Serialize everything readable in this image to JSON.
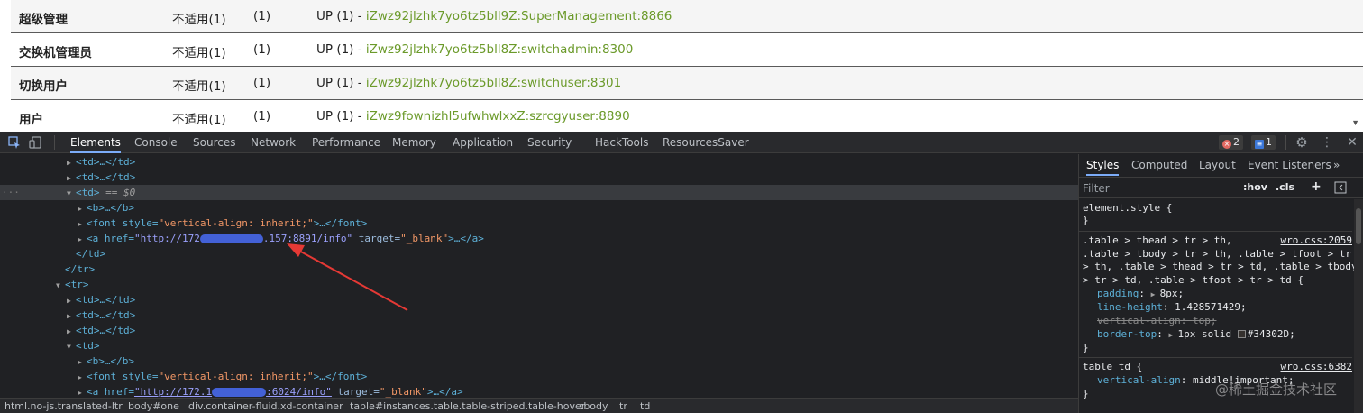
{
  "page_table": {
    "rows": [
      {
        "name": "超级管理",
        "status": "不适用(1)",
        "count": "(1)",
        "up_prefix": "UP (1) - ",
        "up_link": "iZwz92jlzhk7yo6tz5bll9Z:SuperManagement:8866"
      },
      {
        "name": "交换机管理员",
        "status": "不适用(1)",
        "count": "(1)",
        "up_prefix": "UP (1) - ",
        "up_link": "iZwz92jlzhk7yo6tz5bll8Z:switchadmin:8300"
      },
      {
        "name": "切换用户",
        "status": "不适用(1)",
        "count": "(1)",
        "up_prefix": "UP (1) - ",
        "up_link": "iZwz92jlzhk7yo6tz5bll8Z:switchuser:8301"
      },
      {
        "name": "用户",
        "status": "不适用(1)",
        "count": "(1)",
        "up_prefix": "UP (1) - ",
        "up_link": "iZwz9fownizhl5ufwhwlxxZ:szrcgyuser:8890"
      }
    ]
  },
  "devtools": {
    "tabs": [
      "Elements",
      "Console",
      "Sources",
      "Network",
      "Performance",
      "Memory",
      "Application",
      "Security",
      "HackTools",
      "ResourcesSaver"
    ],
    "active_tab": "Elements",
    "error_count": "2",
    "message_count": "1",
    "dom": {
      "td_collapsed": "<td>…</td>",
      "td_open": "<td>",
      "selected_suffix": " == $0",
      "b_collapsed": "<b>…</b>",
      "font_open": "<font style=",
      "font_style": "\"vertical-align: inherit;\"",
      "font_close": ">…</font>",
      "a_open": "<a href=",
      "href1_start": "\"http://172",
      "href1_end": ".157:8891/info\"",
      "href2_start": "\"http://172.1",
      "href2_end": ":6024/info\"",
      "target_attr": " target=",
      "target_val": "\"_blank\"",
      "a_close": ">…</a>",
      "td_close": "</td>",
      "tr_close": "</tr>",
      "tr_open": "<tr>",
      "gutter": "···"
    },
    "breadcrumbs": [
      "html.no-js.translated-ltr",
      "body#one",
      "div.container-fluid.xd-container",
      "table#instances.table.table-striped.table-hover",
      "tbody",
      "tr",
      "td"
    ],
    "styles": {
      "tabs": [
        "Styles",
        "Computed",
        "Layout",
        "Event Listeners"
      ],
      "active_tab": "Styles",
      "more": "»",
      "filter_placeholder": "Filter",
      "hov": ":hov",
      "cls": ".cls",
      "plus": "+",
      "element_style": "element.style {",
      "close_brace": "}",
      "rule1_selector": [
        ".table > thead > tr > th,",
        ".table > tbody > tr > th, .table > tfoot > tr",
        "> th, .table > thead > tr > td, .table > tbody",
        "> tr > td, .table > tfoot > tr > td {"
      ],
      "rule1_source": "wro.css:2059",
      "rule1_props": [
        {
          "name": "padding",
          "value": "8px;",
          "arrow": true,
          "struck": false
        },
        {
          "name": "line-height",
          "value": "1.428571429;",
          "arrow": false,
          "struck": false
        },
        {
          "name": "vertical-align",
          "value": "top;",
          "arrow": false,
          "struck": true
        },
        {
          "name": "border-top",
          "value": "1px solid ",
          "arrow": true,
          "struck": false,
          "color": "#34302D;"
        }
      ],
      "rule2_selector": "table td {",
      "rule2_source": "wro.css:6382",
      "rule2_prop": "vertical-align",
      "rule2_value": "middle!important;"
    },
    "watermark": "@稀土掘金技术社区"
  },
  "colors": {
    "link_green": "#6b9a2a",
    "devtools_bg": "#202124",
    "annotation_arrow": "#e53935",
    "redaction": "#4a6cf7"
  }
}
